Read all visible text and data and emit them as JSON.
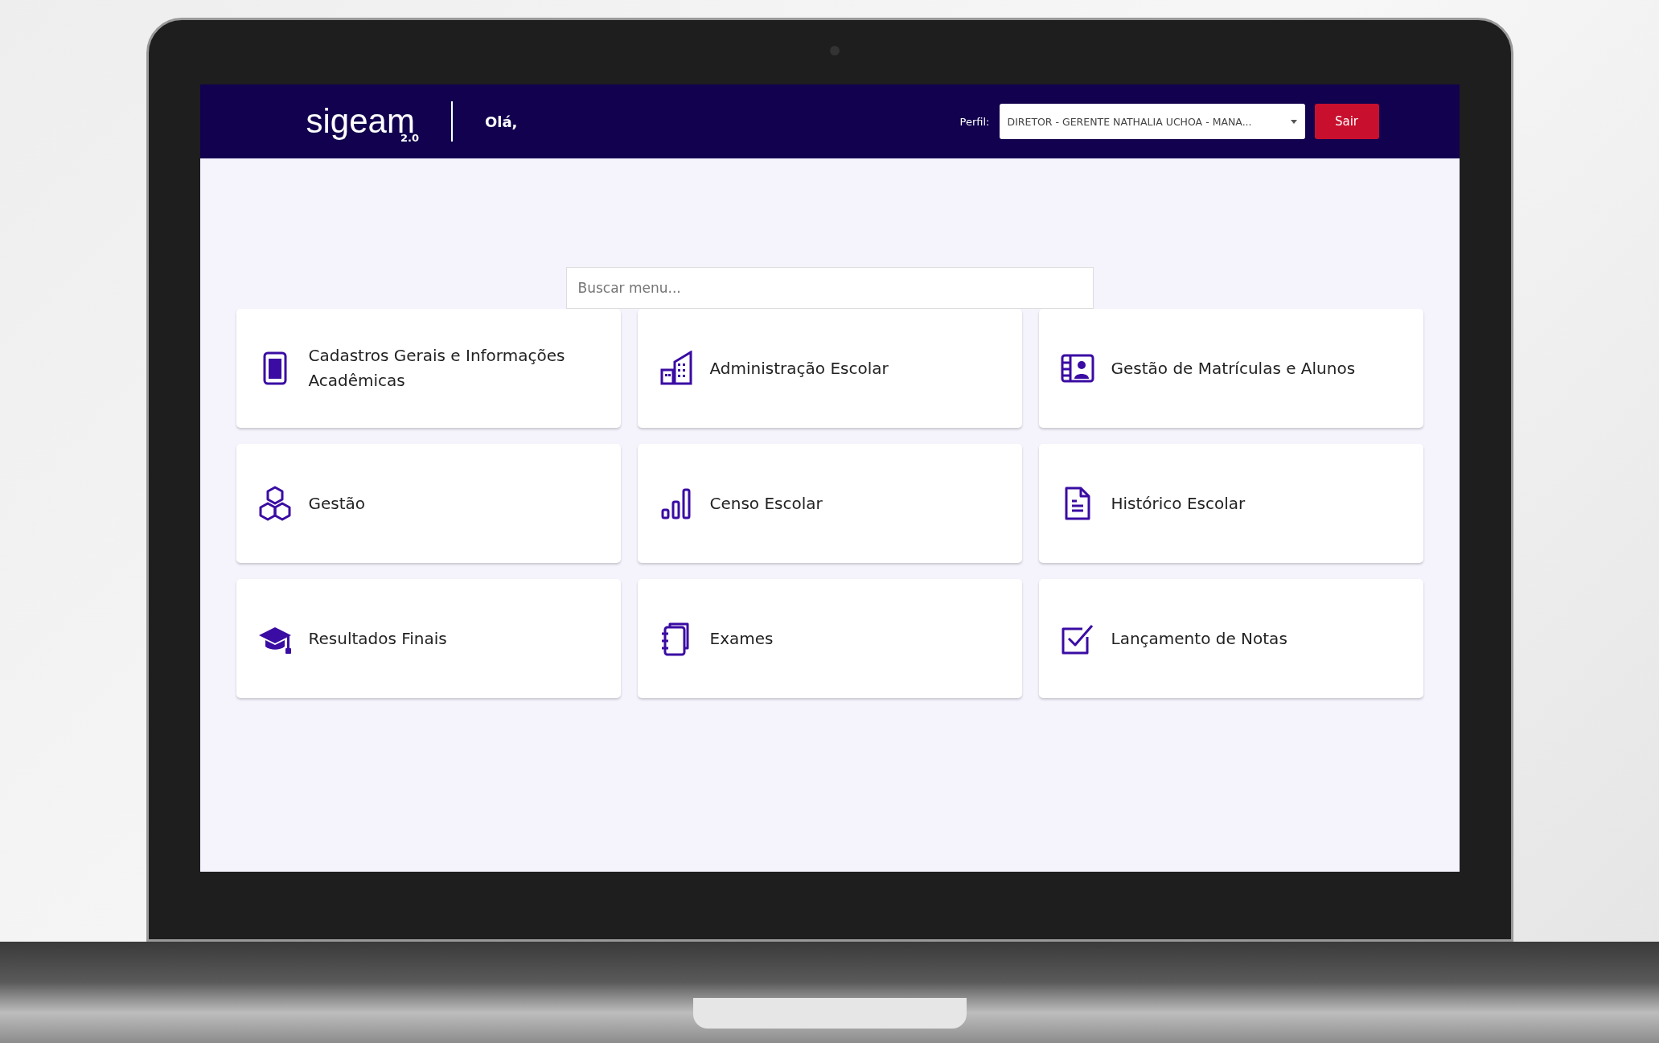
{
  "header": {
    "logo": {
      "name": "sigeam",
      "version": "2.0"
    },
    "greeting": "Olá,",
    "profile": {
      "label": "Perfil:",
      "value": "DIRETOR - GERENTE NATHALIA UCHOA - MANA..."
    },
    "logout_button": "Sair"
  },
  "search": {
    "placeholder": "Buscar menu..."
  },
  "menu_cards": [
    {
      "label": "Cadastros Gerais e Informações Acadêmicas"
    },
    {
      "label": "Administração Escolar"
    },
    {
      "label": "Gestão de Matrículas e Alunos"
    },
    {
      "label": "Gestão"
    },
    {
      "label": "Censo Escolar"
    },
    {
      "label": "Histórico Escolar"
    },
    {
      "label": "Resultados Finais"
    },
    {
      "label": "Exames"
    },
    {
      "label": "Lançamento de Notas"
    }
  ]
}
